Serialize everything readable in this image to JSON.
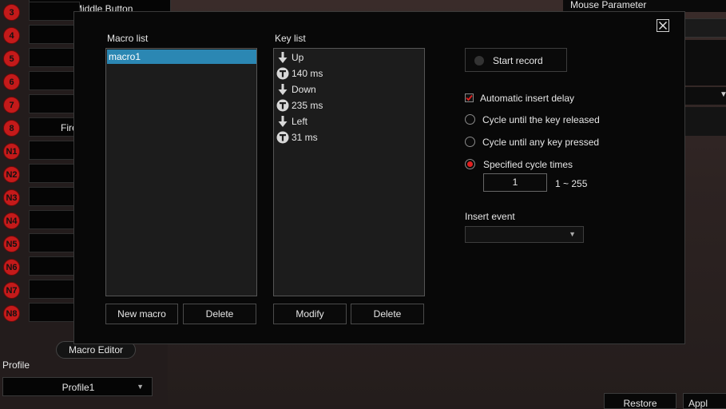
{
  "background": {
    "top_button_label": "Middle Button",
    "mouse_parameter_title": "Mouse Parameter",
    "side_button_fragment": "Fire",
    "button_rows": [
      "3",
      "4",
      "5",
      "6",
      "7",
      "8",
      "N1",
      "N2",
      "N3",
      "N4",
      "N5",
      "N6",
      "N7",
      "N8"
    ],
    "macro_editor_label": "Macro Editor",
    "profile_label": "Profile",
    "profile_value": "Profile1",
    "restore_label": "Restore",
    "apply_label": "Appl",
    "dropdown_arrow": "▼"
  },
  "dialog": {
    "macro_list_label": "Macro list",
    "macros": [
      "macro1"
    ],
    "key_list_label": "Key list",
    "keys": [
      {
        "icon": "arrow-down-icon",
        "text": "Up"
      },
      {
        "icon": "timer-icon",
        "text": "140 ms"
      },
      {
        "icon": "arrow-down-icon",
        "text": "Down"
      },
      {
        "icon": "timer-icon",
        "text": "235 ms"
      },
      {
        "icon": "arrow-down-icon",
        "text": "Left"
      },
      {
        "icon": "timer-icon",
        "text": "31 ms"
      }
    ],
    "new_macro_label": "New macro",
    "delete_macro_label": "Delete",
    "modify_label": "Modify",
    "delete_key_label": "Delete",
    "start_record_label": "Start record",
    "auto_insert_delay_label": "Automatic insert delay",
    "auto_insert_delay_checked": true,
    "cycle_released_label": "Cycle until the key released",
    "cycle_any_key_label": "Cycle until any key pressed",
    "specified_cycle_label": "Specified cycle times",
    "selected_cycle_mode": "specified",
    "cycle_times_value": "1",
    "cycle_range_label": "1 ~ 255",
    "insert_event_label": "Insert event",
    "insert_event_value": ""
  },
  "colors": {
    "accent_red": "#e02020",
    "selection_blue": "#2b87b3"
  }
}
